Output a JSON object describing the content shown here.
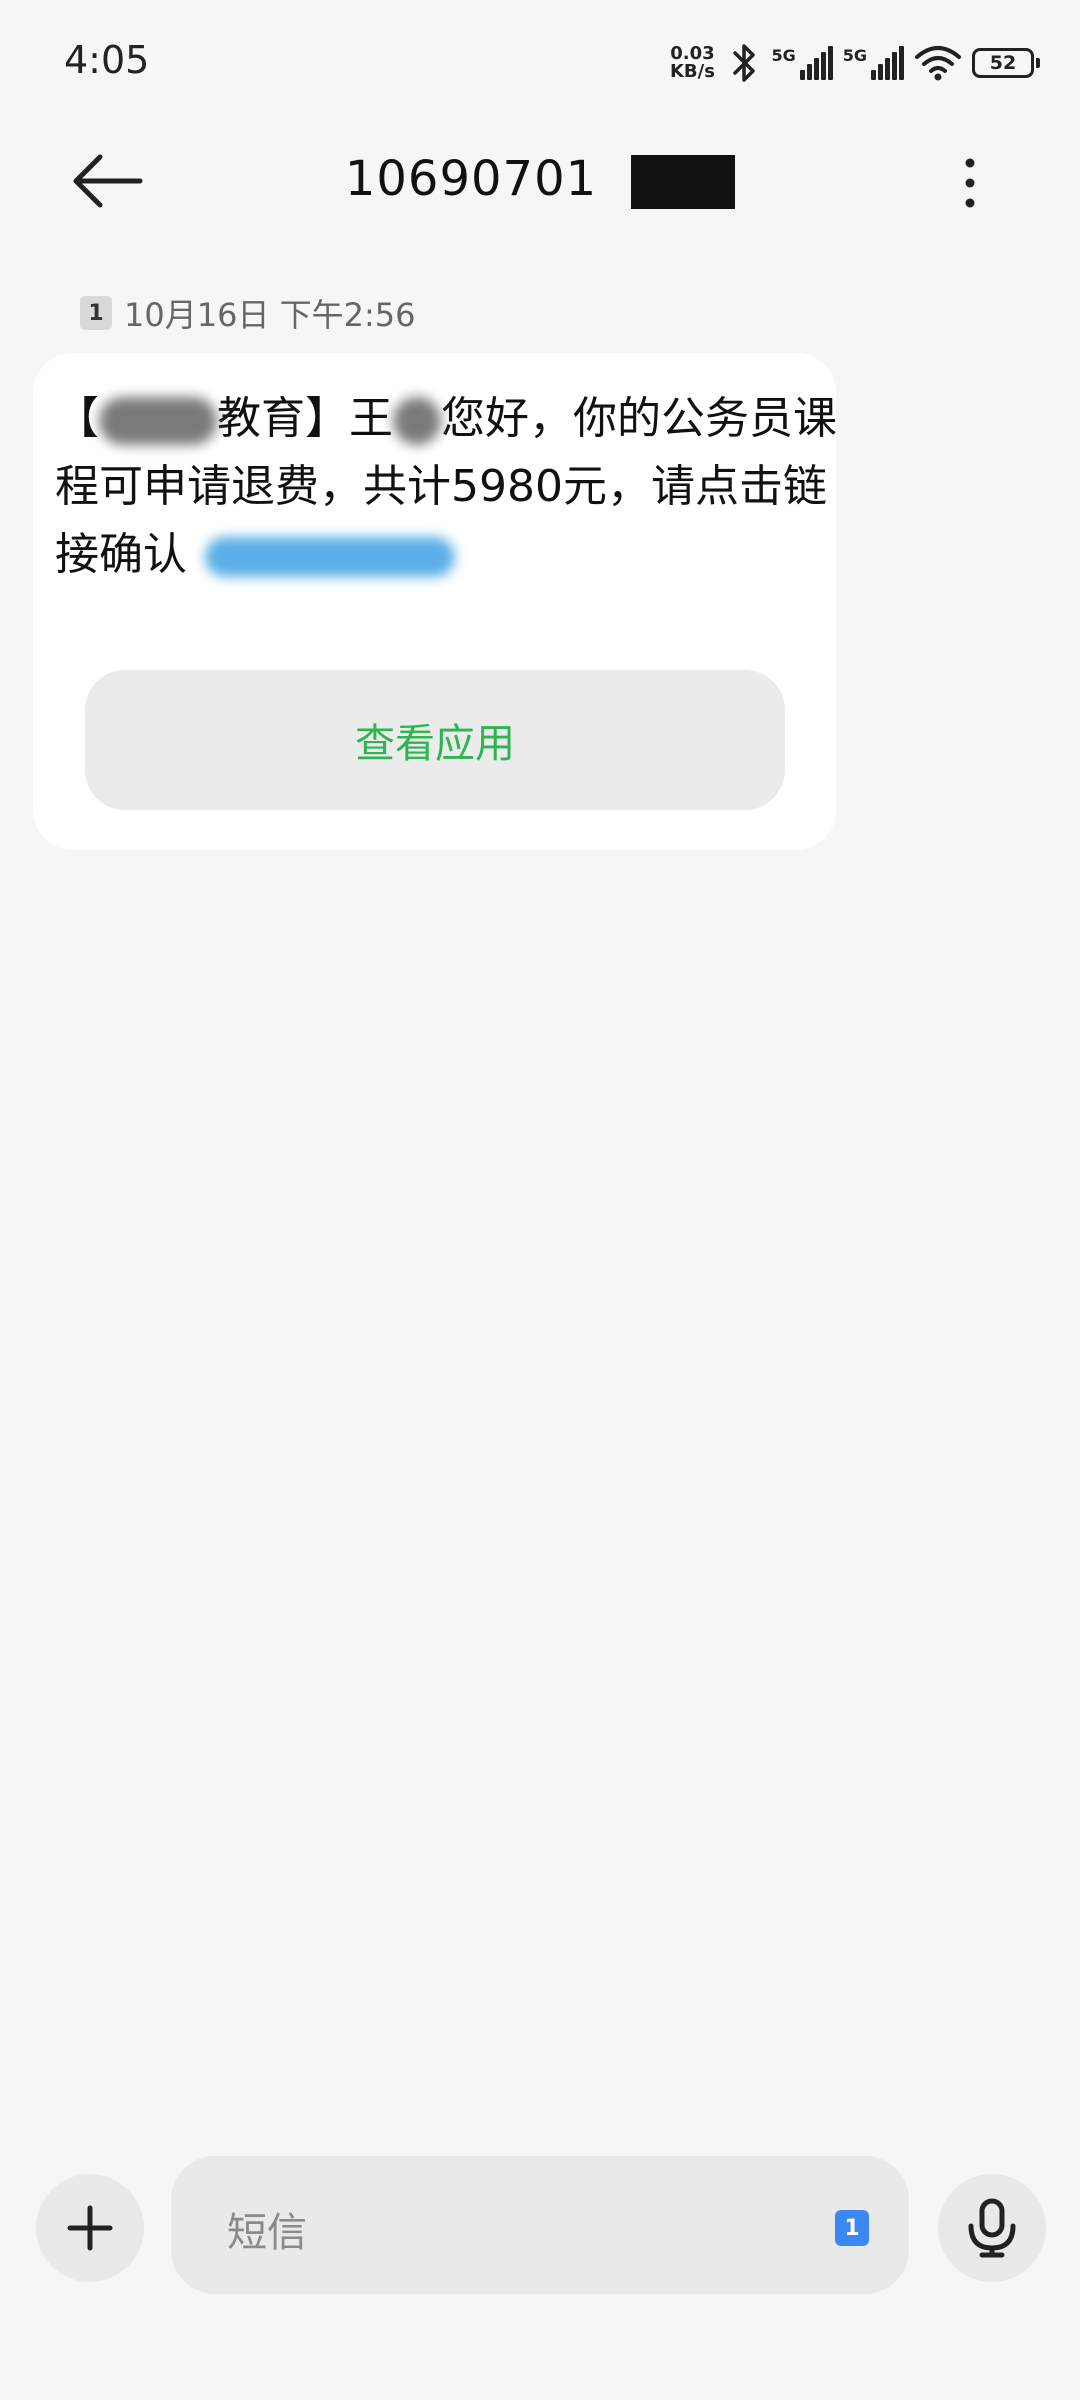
{
  "status_bar": {
    "time": "4:05",
    "net_speed_value": "0.03",
    "net_speed_unit": "KB/s",
    "signal1_label": "5G",
    "signal2_label": "5G",
    "battery": "52"
  },
  "header": {
    "title": "10690701"
  },
  "message": {
    "sim_slot": "1",
    "timestamp": "10月16日 下午2:56",
    "text_part1": "【",
    "text_part2": "教育】王",
    "text_part3": "您好，你的公务员课程可申请退费，共计5980元，请点击链接确认",
    "action_button": "查看应用"
  },
  "composer": {
    "placeholder": "短信",
    "sim_slot": "1"
  },
  "colors": {
    "background": "#f6f6f6",
    "bubble": "#ffffff",
    "action_text": "#2fb44f",
    "sim_badge": "#3d87f5"
  }
}
